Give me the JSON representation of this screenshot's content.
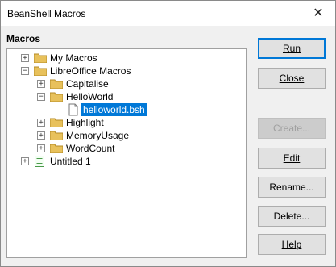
{
  "window": {
    "title": "BeanShell Macros",
    "close_glyph": "✕"
  },
  "panel": {
    "label": "Macros"
  },
  "tree": [
    {
      "label": "My Macros",
      "expander": "+",
      "icon": "folder-icon"
    },
    {
      "label": "LibreOffice Macros",
      "expander": "−",
      "icon": "folder-icon"
    },
    {
      "label": "Capitalise",
      "expander": "+",
      "icon": "folder-icon"
    },
    {
      "label": "HelloWorld",
      "expander": "−",
      "icon": "folder-icon"
    },
    {
      "label": "helloworld.bsh",
      "expander": "",
      "icon": "file-icon",
      "selected": true
    },
    {
      "label": "Highlight",
      "expander": "+",
      "icon": "folder-icon"
    },
    {
      "label": "MemoryUsage",
      "expander": "+",
      "icon": "folder-icon"
    },
    {
      "label": "WordCount",
      "expander": "+",
      "icon": "folder-icon"
    },
    {
      "label": "Untitled 1",
      "expander": "+",
      "icon": "document-icon"
    }
  ],
  "buttons": {
    "run": {
      "label": "Run",
      "enabled": true,
      "default": true
    },
    "close": {
      "label": "Close",
      "enabled": true
    },
    "create": {
      "label": "Create...",
      "enabled": false
    },
    "edit": {
      "label": "Edit",
      "enabled": true
    },
    "rename": {
      "label": "Rename...",
      "enabled": true
    },
    "delete": {
      "label": "Delete...",
      "enabled": true
    },
    "help": {
      "label": "Help",
      "enabled": true
    }
  },
  "colors": {
    "selection": "#0078d7",
    "folder": "#e8c15b"
  }
}
